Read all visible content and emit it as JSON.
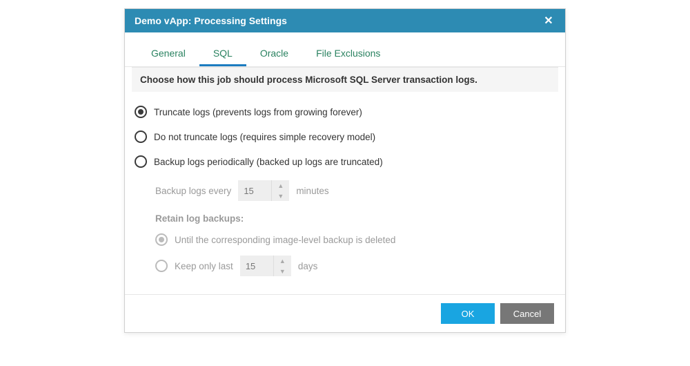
{
  "dialog": {
    "title": "Demo vApp: Processing Settings"
  },
  "tabs": {
    "general": "General",
    "sql": "SQL",
    "oracle": "Oracle",
    "file_exclusions": "File Exclusions"
  },
  "instruction": "Choose how this job should process Microsoft SQL Server transaction logs.",
  "options": {
    "truncate": "Truncate logs (prevents logs from growing forever)",
    "do_not_truncate": "Do not truncate logs (requires simple recovery model)",
    "backup_periodically": "Backup logs periodically (backed up logs are truncated)"
  },
  "backup": {
    "every_label": "Backup logs every",
    "every_value": "15",
    "every_unit": "minutes",
    "retain_heading": "Retain log backups:",
    "until_deleted": "Until the corresponding image-level backup is deleted",
    "keep_only_last": "Keep only last",
    "keep_value": "15",
    "keep_unit": "days"
  },
  "buttons": {
    "ok": "OK",
    "cancel": "Cancel"
  }
}
